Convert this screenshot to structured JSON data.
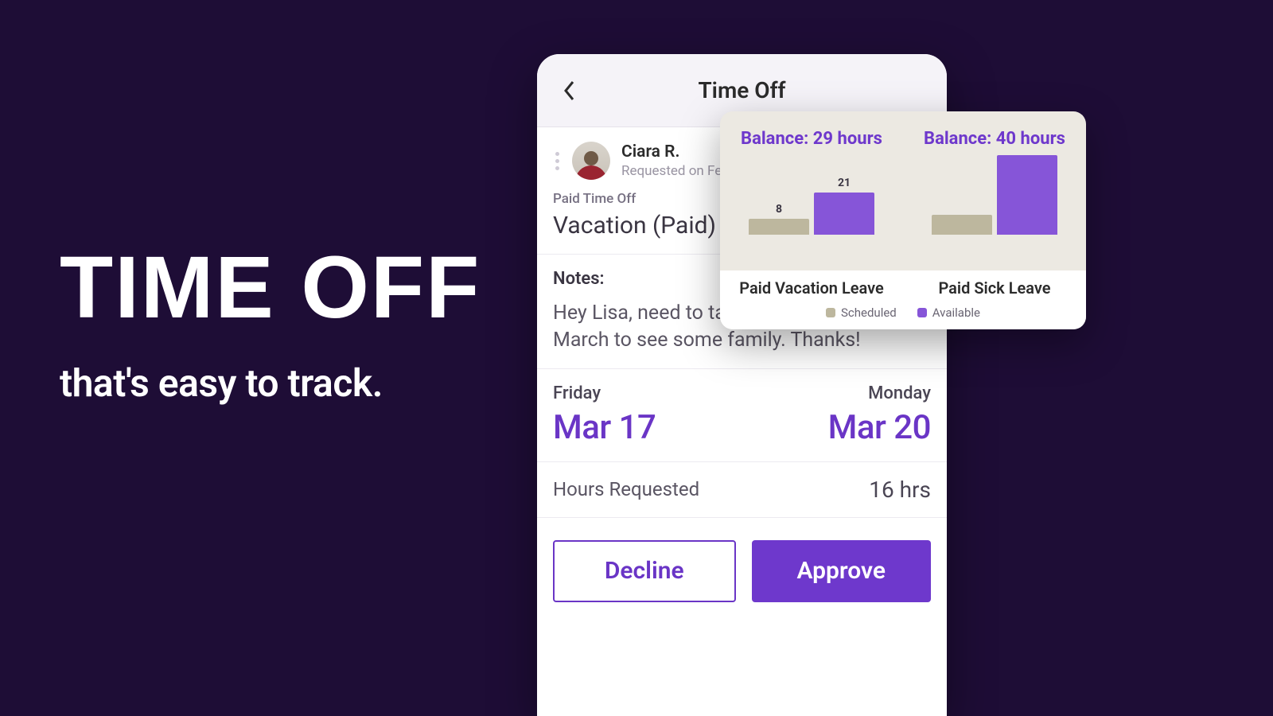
{
  "headline": {
    "title": "TIME OFF",
    "subtitle": "that's easy to track."
  },
  "phone": {
    "title": "Time Off",
    "requester": {
      "name": "Ciara R.",
      "requested_on_prefix": "Requested on Febru"
    },
    "pto_category_label": "Paid Time Off",
    "pto_type": "Vacation (Paid)",
    "notes_label": "Notes:",
    "notes_body": "Hey Lisa, need to take a couple days in March to see some family. Thanks!",
    "start": {
      "dow": "Friday",
      "date": "Mar 17"
    },
    "end": {
      "dow": "Monday",
      "date": "Mar 20"
    },
    "hours_label": "Hours Requested",
    "hours_value": "16 hrs",
    "decline_label": "Decline",
    "approve_label": "Approve"
  },
  "balance": {
    "legend": {
      "scheduled": "Scheduled",
      "available": "Available"
    }
  },
  "chart_data": [
    {
      "type": "bar",
      "title": "Balance: 29 hours",
      "xlabel": "Paid Vacation Leave",
      "ylabel": "",
      "categories": [
        "Scheduled",
        "Available"
      ],
      "values": [
        8,
        21
      ],
      "ylim": [
        0,
        40
      ]
    },
    {
      "type": "bar",
      "title": "Balance: 40 hours",
      "xlabel": "Paid Sick Leave",
      "ylabel": "",
      "categories": [
        "Scheduled",
        "Available"
      ],
      "values": [
        10,
        40
      ],
      "ylim": [
        0,
        40
      ]
    }
  ]
}
